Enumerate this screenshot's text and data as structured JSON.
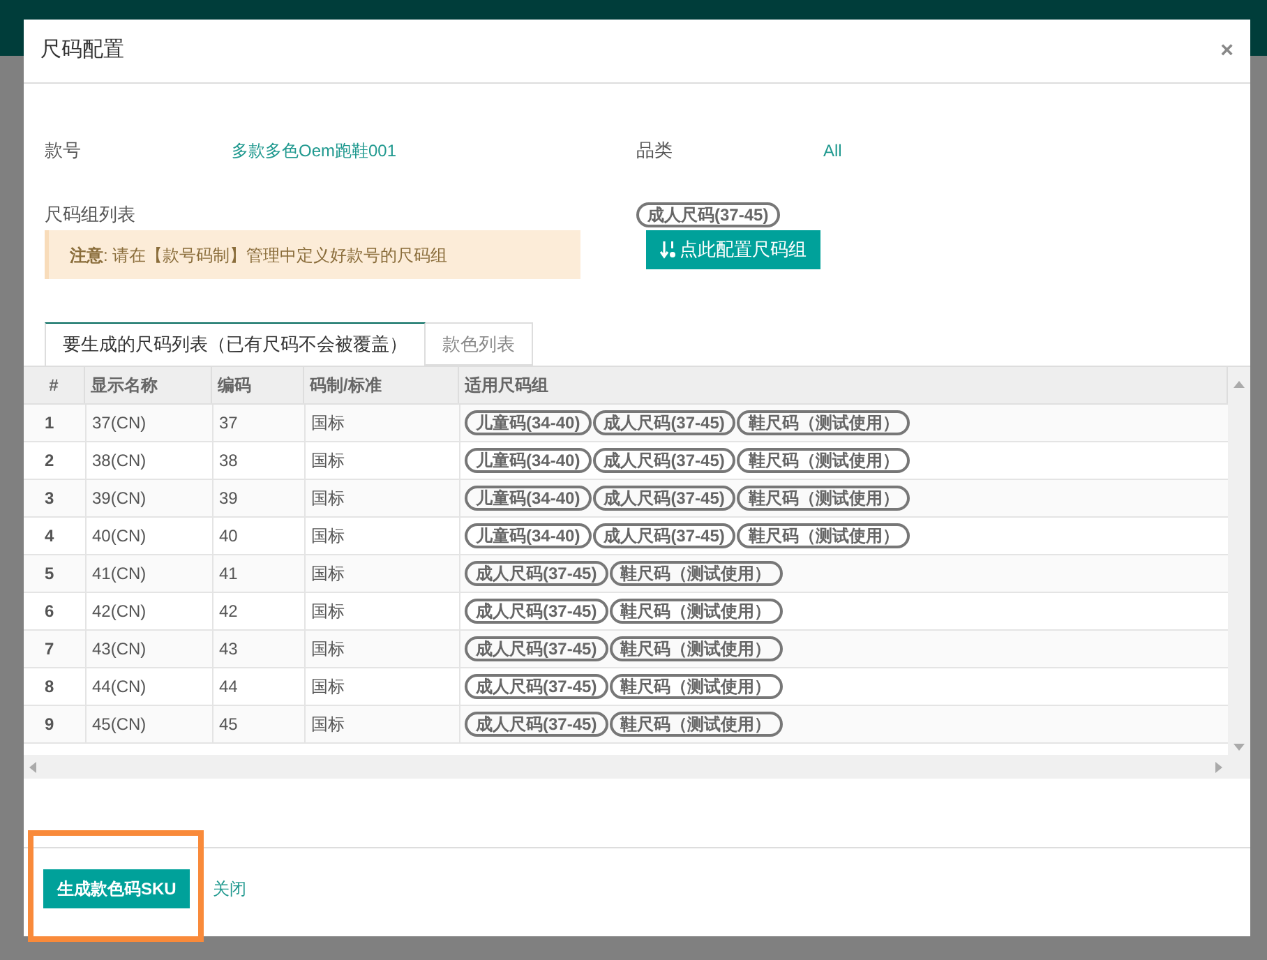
{
  "dialog": {
    "title": "尺码配置",
    "close": "×"
  },
  "fields": [
    {
      "label": "款号",
      "value": "多款多色Oem跑鞋001"
    },
    {
      "label": "品类",
      "value": "All"
    }
  ],
  "size_groups": {
    "label": "尺码组列表",
    "notice_strong": "注意",
    "notice": ": 请在【款号码制】管理中定义好款号的尺码组",
    "selected_tags": [
      "成人尺码(37-45)"
    ],
    "config_button": "点此配置尺码组"
  },
  "tabs": [
    {
      "label": "要生成的尺码列表（已有尺码不会被覆盖）",
      "selected": true
    },
    {
      "label": "款色列表",
      "selected": false
    }
  ],
  "table": {
    "columns": [
      "#",
      "显示名称",
      "编码",
      "码制/标准",
      "适用尺码组"
    ],
    "rows": [
      {
        "index": "1",
        "name": "37(CN)",
        "code": "37",
        "standard": "国标",
        "groups": [
          "儿童码(34-40)",
          "成人尺码(37-45)",
          "鞋尺码（测试使用）"
        ]
      },
      {
        "index": "2",
        "name": "38(CN)",
        "code": "38",
        "standard": "国标",
        "groups": [
          "儿童码(34-40)",
          "成人尺码(37-45)",
          "鞋尺码（测试使用）"
        ]
      },
      {
        "index": "3",
        "name": "39(CN)",
        "code": "39",
        "standard": "国标",
        "groups": [
          "儿童码(34-40)",
          "成人尺码(37-45)",
          "鞋尺码（测试使用）"
        ]
      },
      {
        "index": "4",
        "name": "40(CN)",
        "code": "40",
        "standard": "国标",
        "groups": [
          "儿童码(34-40)",
          "成人尺码(37-45)",
          "鞋尺码（测试使用）"
        ]
      },
      {
        "index": "5",
        "name": "41(CN)",
        "code": "41",
        "standard": "国标",
        "groups": [
          "成人尺码(37-45)",
          "鞋尺码（测试使用）"
        ]
      },
      {
        "index": "6",
        "name": "42(CN)",
        "code": "42",
        "standard": "国标",
        "groups": [
          "成人尺码(37-45)",
          "鞋尺码（测试使用）"
        ]
      },
      {
        "index": "7",
        "name": "43(CN)",
        "code": "43",
        "standard": "国标",
        "groups": [
          "成人尺码(37-45)",
          "鞋尺码（测试使用）"
        ]
      },
      {
        "index": "8",
        "name": "44(CN)",
        "code": "44",
        "standard": "国标",
        "groups": [
          "成人尺码(37-45)",
          "鞋尺码（测试使用）"
        ]
      },
      {
        "index": "9",
        "name": "45(CN)",
        "code": "45",
        "standard": "国标",
        "groups": [
          "成人尺码(37-45)",
          "鞋尺码（测试使用）"
        ]
      }
    ]
  },
  "footer": {
    "primary_button": "生成款色码SKU",
    "close_link": "关闭",
    "highlighted": true
  }
}
